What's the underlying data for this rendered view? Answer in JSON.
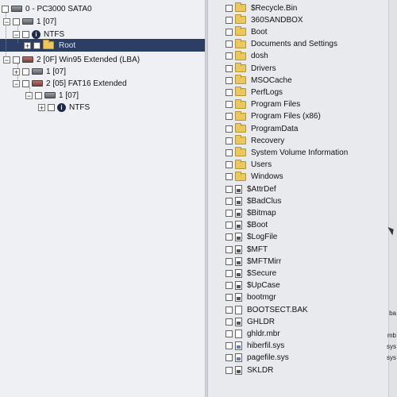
{
  "tree": {
    "items": [
      {
        "label": "0 - PC3000 SATA0",
        "icon": "disk-icon"
      },
      {
        "label": "1 [07]",
        "icon": "disk-icon"
      },
      {
        "label": "NTFS",
        "icon": "info-icon"
      },
      {
        "label": "Root",
        "icon": "folder-icon"
      },
      {
        "label": "2 [0F] Win95 Extended  (LBA)",
        "icon": "disk-icon"
      },
      {
        "label": "1 [07]",
        "icon": "disk-icon"
      },
      {
        "label": "2 [05] FAT16 Extended",
        "icon": "disk-icon"
      },
      {
        "label": "1 [07]",
        "icon": "disk-icon"
      },
      {
        "label": "NTFS",
        "icon": "info-icon"
      }
    ]
  },
  "files": {
    "items": [
      {
        "name": "$Recycle.Bin",
        "type": "folder"
      },
      {
        "name": "360SANDBOX",
        "type": "folder"
      },
      {
        "name": "Boot",
        "type": "folder"
      },
      {
        "name": "Documents and Settings",
        "type": "folder"
      },
      {
        "name": "dosh",
        "type": "folder"
      },
      {
        "name": "Drivers",
        "type": "folder"
      },
      {
        "name": "MSOCache",
        "type": "folder"
      },
      {
        "name": "PerfLogs",
        "type": "folder"
      },
      {
        "name": "Program Files",
        "type": "folder"
      },
      {
        "name": "Program Files (x86)",
        "type": "folder"
      },
      {
        "name": "ProgramData",
        "type": "folder"
      },
      {
        "name": "Recovery",
        "type": "folder"
      },
      {
        "name": "System Volume Information",
        "type": "folder"
      },
      {
        "name": "Users",
        "type": "folder"
      },
      {
        "name": "Windows",
        "type": "folder"
      },
      {
        "name": "$AttrDef",
        "type": "file"
      },
      {
        "name": "$BadClus",
        "type": "file"
      },
      {
        "name": "$Bitmap",
        "type": "file"
      },
      {
        "name": "$Boot",
        "type": "file"
      },
      {
        "name": "$LogFile",
        "type": "file"
      },
      {
        "name": "$MFT",
        "type": "file"
      },
      {
        "name": "$MFTMirr",
        "type": "file"
      },
      {
        "name": "$Secure",
        "type": "file"
      },
      {
        "name": "$UpCase",
        "type": "file"
      },
      {
        "name": "bootmgr",
        "type": "file"
      },
      {
        "name": "BOOTSECT.BAK",
        "type": "plain"
      },
      {
        "name": "GHLDR",
        "type": "file"
      },
      {
        "name": "ghldr.mbr",
        "type": "plain"
      },
      {
        "name": "hiberfil.sys",
        "type": "sys"
      },
      {
        "name": "pagefile.sys",
        "type": "sys"
      },
      {
        "name": "SKLDR",
        "type": "file"
      }
    ]
  },
  "edge_column": [
    "ba",
    "mb",
    "sys",
    "sys"
  ]
}
